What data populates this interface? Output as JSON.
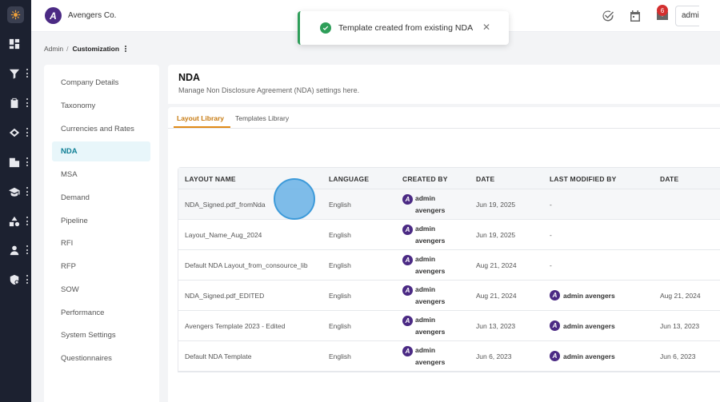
{
  "header": {
    "org_name": "Avengers Co.",
    "logo_letter": "A",
    "notification_count": "6",
    "user_label": "admin"
  },
  "breadcrumb": {
    "root": "Admin",
    "separator": "/",
    "current": "Customization"
  },
  "subnav": {
    "items": [
      {
        "label": "Company Details"
      },
      {
        "label": "Taxonomy"
      },
      {
        "label": "Currencies and Rates"
      },
      {
        "label": "NDA"
      },
      {
        "label": "MSA"
      },
      {
        "label": "Demand"
      },
      {
        "label": "Pipeline"
      },
      {
        "label": "RFI"
      },
      {
        "label": "RFP"
      },
      {
        "label": "SOW"
      },
      {
        "label": "Performance"
      },
      {
        "label": "System Settings"
      },
      {
        "label": "Questionnaires"
      }
    ],
    "active_index": 3
  },
  "page": {
    "title": "NDA",
    "subtitle": "Manage Non Disclosure Agreement (NDA) settings here."
  },
  "tabs": [
    {
      "label": "Layout Library"
    },
    {
      "label": "Templates Library"
    }
  ],
  "table": {
    "columns": [
      "LAYOUT NAME",
      "LANGUAGE",
      "CREATED BY",
      "DATE",
      "LAST MODIFIED BY",
      "DATE"
    ],
    "rows": [
      {
        "name": "NDA_Signed.pdf_fromNda",
        "language": "English",
        "created_by": "admin avengers",
        "date": "Jun 19, 2025",
        "modified_by": "-",
        "modified_date": ""
      },
      {
        "name": "Layout_Name_Aug_2024",
        "language": "English",
        "created_by": "admin avengers",
        "date": "Jun 19, 2025",
        "modified_by": "-",
        "modified_date": ""
      },
      {
        "name": "Default NDA Layout_from_consource_lib",
        "language": "English",
        "created_by": "admin avengers",
        "date": "Aug 21, 2024",
        "modified_by": "-",
        "modified_date": ""
      },
      {
        "name": "NDA_Signed.pdf_EDITED",
        "language": "English",
        "created_by": "admin avengers",
        "date": "Aug 21, 2024",
        "modified_by": "admin avengers",
        "modified_date": "Aug 21, 2024"
      },
      {
        "name": "Avengers Template 2023 - Edited",
        "language": "English",
        "created_by": "admin avengers",
        "date": "Jun 13, 2023",
        "modified_by": "admin avengers",
        "modified_date": "Jun 13, 2023"
      },
      {
        "name": "Default NDA Template",
        "language": "English",
        "created_by": "admin avengers",
        "date": "Jun 6, 2023",
        "modified_by": "admin avengers",
        "modified_date": "Jun 6, 2023"
      }
    ]
  },
  "toast": {
    "message": "Template created from existing NDA",
    "status_color": "#2e9e59"
  },
  "colors": {
    "accent": "#e08a17",
    "active_nav": "#0f7f95",
    "rail": "#1c2130",
    "brand": "#4b2a84"
  },
  "icons": {
    "rail": [
      "app-logo-icon",
      "dashboard-icon",
      "filter-icon",
      "clipboard-icon",
      "handshake-icon",
      "building-icon",
      "graduation-cap-icon",
      "shapes-icon",
      "user-icon",
      "shield-settings-icon"
    ],
    "header": [
      "check-circle-icon",
      "calendar-icon",
      "mail-icon",
      "bell-icon"
    ]
  }
}
